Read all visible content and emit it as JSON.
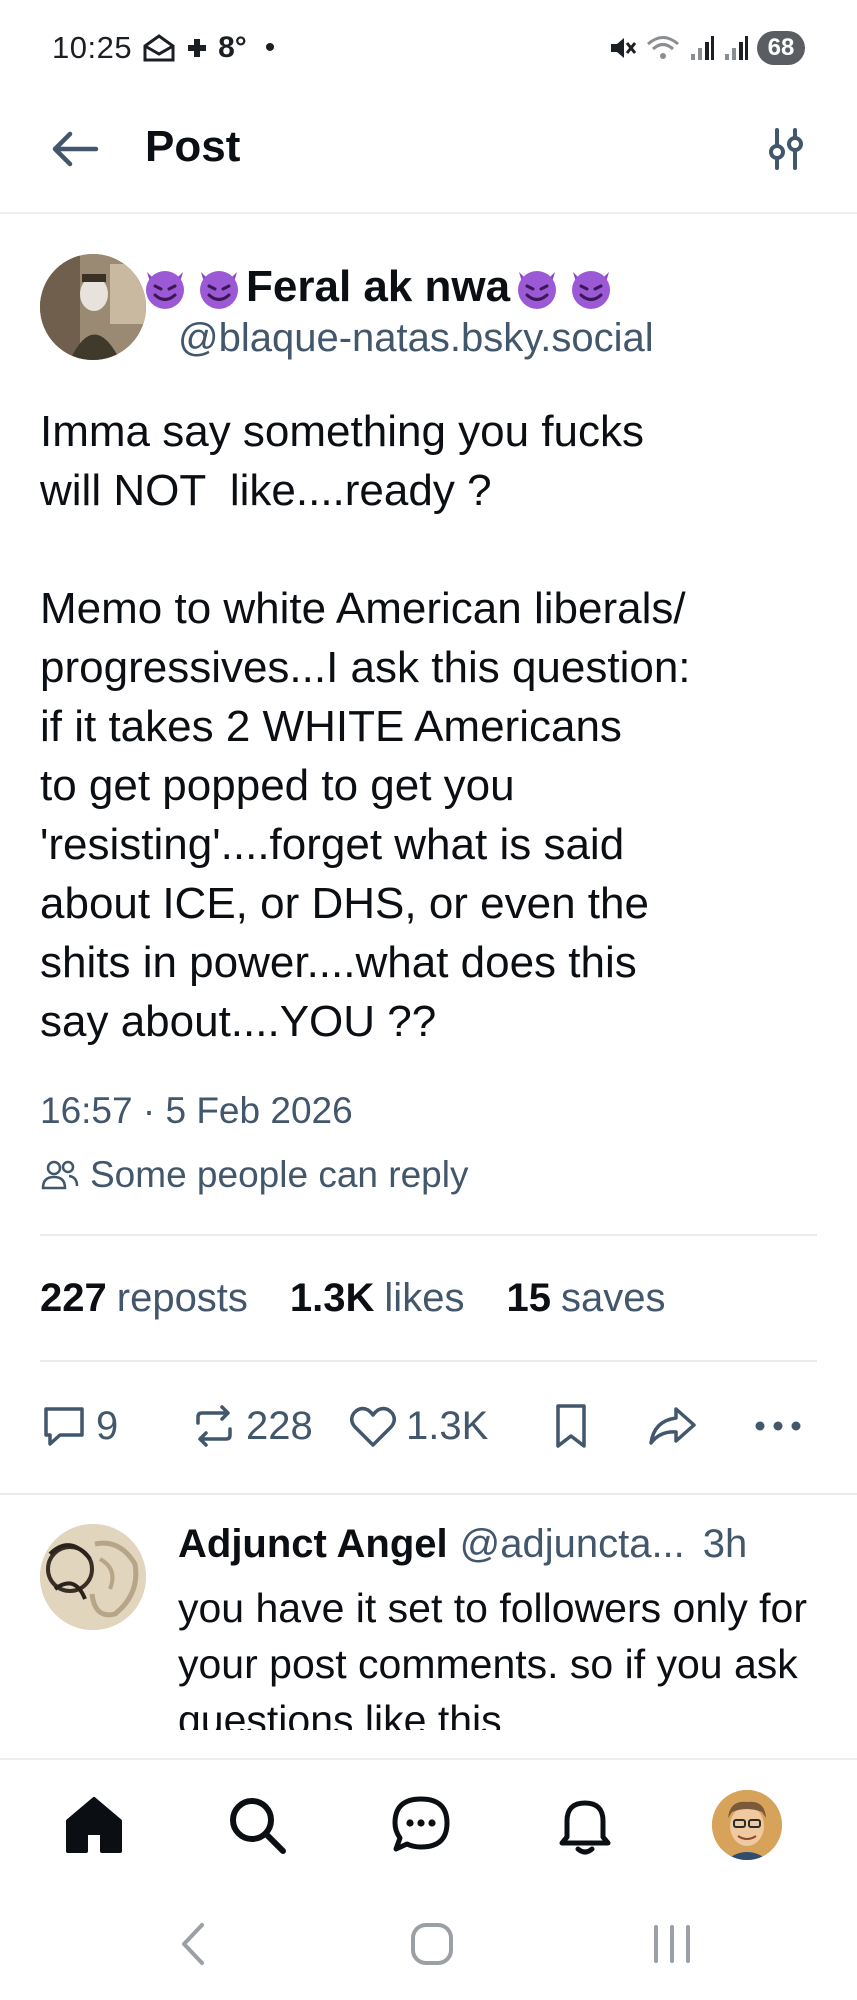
{
  "status_bar": {
    "time": "10:25",
    "temperature": "8°",
    "dot": "•",
    "battery": "68",
    "icons": [
      "mail-badge-icon",
      "weather-icon",
      "mute-icon",
      "wifi-icon",
      "signal-icon",
      "signal-icon-2"
    ]
  },
  "header": {
    "title": "Post",
    "back_icon": "arrow-left-icon",
    "filter_icon": "sliders-icon"
  },
  "post": {
    "display_name": "Feral ak nwa",
    "handle": "@blaque-natas.bsky.social",
    "text": "Imma say something you fucks\nwill NOT  like....ready ?\n\nMemo to white American liberals/\nprogressives...I ask this question:\nif it takes 2 WHITE Americans\nto get popped to get you\n'resisting'....forget what is said\nabout ICE, or DHS, or even the\nshits in power....what does this\nsay about....YOU ??",
    "timestamp": "16:57 · 5 Feb 2026",
    "reply_setting": "Some people can reply",
    "stats": {
      "reposts_count": "227",
      "reposts_label": "reposts",
      "likes_count": "1.3K",
      "likes_label": "likes",
      "saves_count": "15",
      "saves_label": "saves"
    },
    "actions": {
      "replies": "9",
      "reposts": "228",
      "likes": "1.3K"
    }
  },
  "reply": {
    "name": "Adjunct Angel",
    "handle": "@adjuncta...",
    "time": "3h",
    "text": "you have it set to followers only for your post comments. so if you ask questions like this"
  },
  "bottom_nav": [
    "home-icon",
    "search-icon",
    "chat-icon",
    "bell-icon",
    "profile-avatar"
  ],
  "colors": {
    "text": "#0b0f14",
    "muted": "#42576c",
    "emoji_purple": "#9b59d6",
    "divider": "#e9ecef"
  }
}
